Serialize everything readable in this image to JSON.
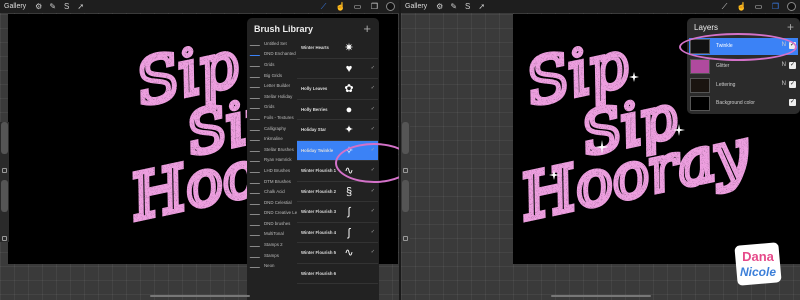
{
  "left": {
    "topbar": {
      "gallery": "Gallery"
    },
    "brush_library": {
      "title": "Brush Library",
      "plus": "+",
      "sets": [
        "Untitled Set",
        "DND Enchanted Wint...",
        "Grids",
        "Big Grids",
        "Letter Builder",
        "Stellar Holiday",
        "Grids",
        "Foils - Textures",
        "Calligraphy",
        "Inkmaline",
        "Stellar Brushes",
        "Ryan Hamrick",
        "LHD Brushes",
        "DTM Brushes",
        "Chalk Acid",
        "DND Celestial",
        "DND Creative Lettering",
        "DND brushes",
        "MultiTonal",
        "Stamps 2",
        "Stamps",
        "Neon"
      ],
      "brushes": [
        {
          "name": "Winter Hearts",
          "preview": "✷",
          "check": ""
        },
        {
          "name": "",
          "preview": "♥",
          "check": "✓"
        },
        {
          "name": "Holly Leaves",
          "preview": "✿",
          "check": "✓"
        },
        {
          "name": "Holly Berries",
          "preview": "●",
          "check": "✓"
        },
        {
          "name": "Holiday Star",
          "preview": "✦",
          "check": "✓"
        },
        {
          "name": "Holiday Twinkle",
          "preview": "✧",
          "check": "✓"
        },
        {
          "name": "Winter Flourish 1",
          "preview": "∿",
          "check": "✓"
        },
        {
          "name": "Winter Flourish 2",
          "preview": "§",
          "check": "✓"
        },
        {
          "name": "Winter Flourish 3",
          "preview": "∫",
          "check": "✓"
        },
        {
          "name": "Winter Flourish 4",
          "preview": "ʃ",
          "check": "✓"
        },
        {
          "name": "Winter Flourish 5",
          "preview": "∿",
          "check": "✓"
        },
        {
          "name": "Winter Flourish 6",
          "preview": "",
          "check": ""
        }
      ]
    },
    "lettering": {
      "line1": "Sip",
      "line2": "Sip",
      "line3": "Hooray"
    }
  },
  "right": {
    "topbar": {
      "gallery": "Gallery"
    },
    "layers_panel": {
      "title": "Layers",
      "plus": "+",
      "layers": [
        {
          "name": "Twinkle",
          "mode": "N"
        },
        {
          "name": "Glitter",
          "mode": "N"
        },
        {
          "name": "Lettering",
          "mode": "N"
        },
        {
          "name": "Background color",
          "mode": ""
        }
      ]
    },
    "lettering": {
      "line1": "Sip",
      "line2": "Sip",
      "line3": "Hooray"
    }
  },
  "logo": {
    "line1": "Dana",
    "line2": "Nicole"
  },
  "colors": {
    "accent": "#3b82f6",
    "glitter": "#c84fb0",
    "highlight": "#d472c9",
    "logo_top": "#e64a8a",
    "logo_bottom": "#3b7fd9"
  }
}
